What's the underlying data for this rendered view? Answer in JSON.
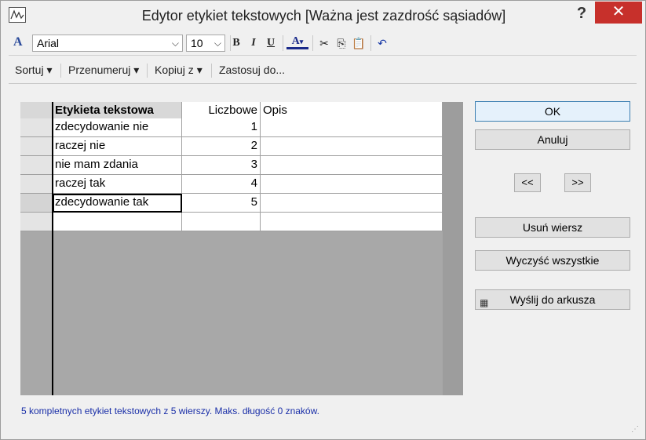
{
  "window": {
    "title": "Edytor etykiet tekstowych [Ważna jest zazdrość sąsiadów]",
    "help_label": "?",
    "close_label": "✕",
    "app_icon": "chart-app-icon"
  },
  "toolbar": {
    "font_icon": "A",
    "font_name": "Arial",
    "font_size": "10",
    "bold": "B",
    "italic": "I",
    "underline": "U",
    "font_color_icon": "A",
    "cut_icon": "scissors-icon",
    "copy_icon": "copy-icon",
    "paste_icon": "paste-icon",
    "undo_icon": "undo-icon"
  },
  "menubar": {
    "sort": "Sortuj ▾",
    "renumber": "Przenumeruj ▾",
    "copy_from": "Kopiuj z ▾",
    "apply_to": "Zastosuj do..."
  },
  "grid": {
    "headers": [
      "Etykieta tekstowa",
      "Liczbowe",
      "Opis"
    ],
    "rows": [
      {
        "label": "zdecydowanie nie",
        "value": "1",
        "desc": ""
      },
      {
        "label": "raczej nie",
        "value": "2",
        "desc": ""
      },
      {
        "label": "nie mam zdania",
        "value": "3",
        "desc": ""
      },
      {
        "label": "raczej tak",
        "value": "4",
        "desc": ""
      },
      {
        "label": "zdecydowanie tak",
        "value": "5",
        "desc": ""
      },
      {
        "label": "",
        "value": "",
        "desc": ""
      }
    ],
    "selected_row": 4
  },
  "buttons": {
    "ok": "OK",
    "cancel": "Anuluj",
    "prev": "<<",
    "next": ">>",
    "delete_row": "Usuń wiersz",
    "clear_all": "Wyczyść wszystkie",
    "send_to_sheet": "Wyślij do arkusza"
  },
  "status": "5 kompletnych etykiet tekstowych z 5 wierszy. Maks. długość 0 znaków."
}
